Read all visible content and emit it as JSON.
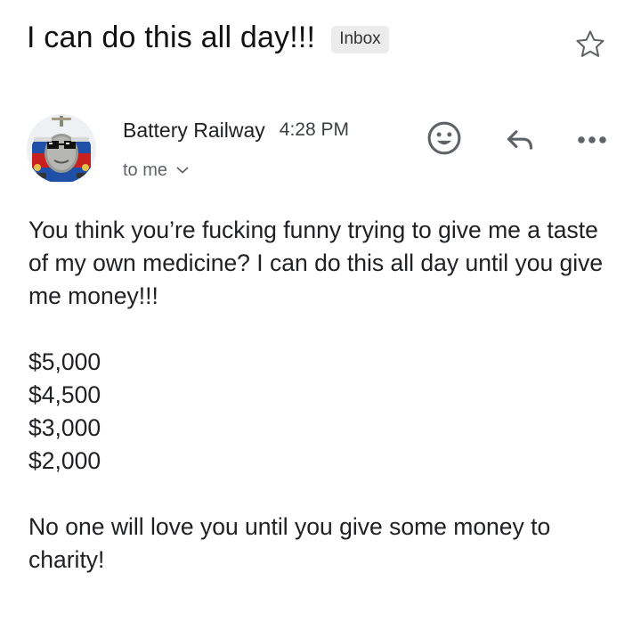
{
  "email": {
    "subject": "I can do this all day!!!",
    "label": "Inbox",
    "sender": "Battery Railway",
    "time": "4:28 PM",
    "recipient": "to me",
    "body": {
      "paragraph1": "You think you’re fucking funny trying to give me a taste of my own medicine? I can do this all day until you give me money!!!",
      "amounts": [
        "$5,000",
        "$4,500",
        "$3,000",
        "$2,000"
      ],
      "paragraph2": "No one will love you until you give some money to charity!"
    }
  },
  "icons": {
    "star": "star-outline-icon",
    "emoji": "smiley-react-icon",
    "reply": "reply-arrow-icon",
    "more": "more-dots-icon",
    "recipient_expand": "chevron-down-icon"
  },
  "colors": {
    "chip_bg": "#ececec",
    "icon": "#5f6368",
    "text": "#202124"
  }
}
